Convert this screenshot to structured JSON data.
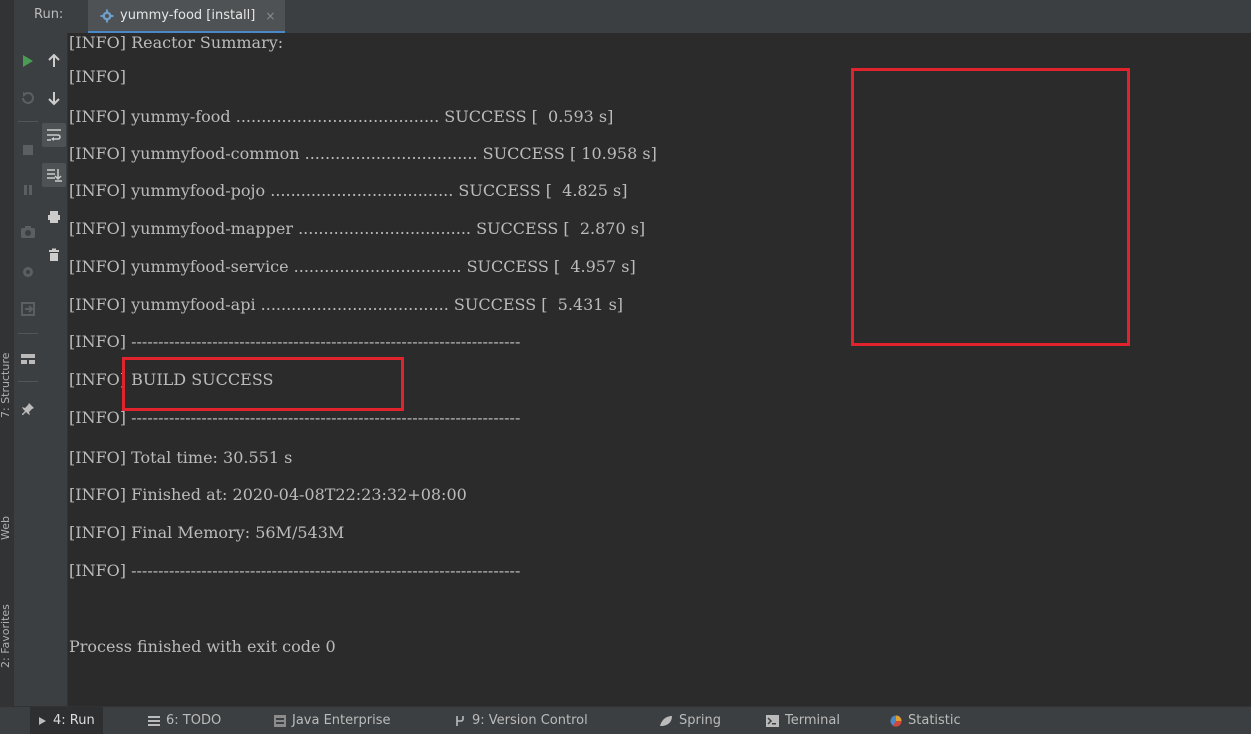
{
  "side_tabs": [
    "7: Structure",
    "Web",
    "2: Favorites"
  ],
  "header": {
    "run_label": "Run:",
    "tab_title": "yummy-food [install]",
    "tab_close": "×"
  },
  "toolbar": {
    "left_icons": [
      "rerun-icon",
      "rerun-failed-icon",
      "stop-icon",
      "pause-icon",
      "dump-threads-icon",
      "settings-icon",
      "exit-icon",
      "layout-icon",
      "pin-icon"
    ],
    "right_icons": [
      "up-arrow-icon",
      "down-arrow-icon",
      "soft-wrap-icon",
      "scroll-to-end-icon",
      "print-icon",
      "clear-all-icon"
    ]
  },
  "console": {
    "lines": [
      "[INFO] Reactor Summary:",
      "[INFO]",
      "[INFO] yummy-food ........................................ SUCCESS [  0.593 s]",
      "[INFO] yummyfood-common .................................. SUCCESS [ 10.958 s]",
      "[INFO] yummyfood-pojo .................................... SUCCESS [  4.825 s]",
      "[INFO] yummyfood-mapper .................................. SUCCESS [  2.870 s]",
      "[INFO] yummyfood-service ................................. SUCCESS [  4.957 s]",
      "[INFO] yummyfood-api ..................................... SUCCESS [  5.431 s]",
      "[INFO] ------------------------------------------------------------------------",
      "[INFO] BUILD SUCCESS",
      "[INFO] ------------------------------------------------------------------------",
      "[INFO] Total time: 30.551 s",
      "[INFO] Finished at: 2020-04-08T22:23:32+08:00",
      "[INFO] Final Memory: 56M/543M",
      "[INFO] ------------------------------------------------------------------------",
      "",
      "Process finished with exit code 0"
    ]
  },
  "bottom_bar": {
    "tabs": [
      {
        "label": "4: Run",
        "icon": "play-icon"
      },
      {
        "label": "6: TODO",
        "icon": "list-icon"
      },
      {
        "label": "Java Enterprise",
        "icon": "java-enterprise-icon"
      },
      {
        "label": "9: Version Control",
        "icon": "version-control-icon"
      },
      {
        "label": "Spring",
        "icon": "spring-leaf-icon"
      },
      {
        "label": "Terminal",
        "icon": "terminal-icon"
      },
      {
        "label": "Statistic",
        "icon": "statistic-icon"
      }
    ]
  },
  "colors": {
    "background": "#2b2b2b",
    "panel": "#3c3f41",
    "text": "#bbbbbb",
    "highlight_box": "#e0232c",
    "run_green": "#499c54",
    "accent_blue": "#4a88c7"
  }
}
